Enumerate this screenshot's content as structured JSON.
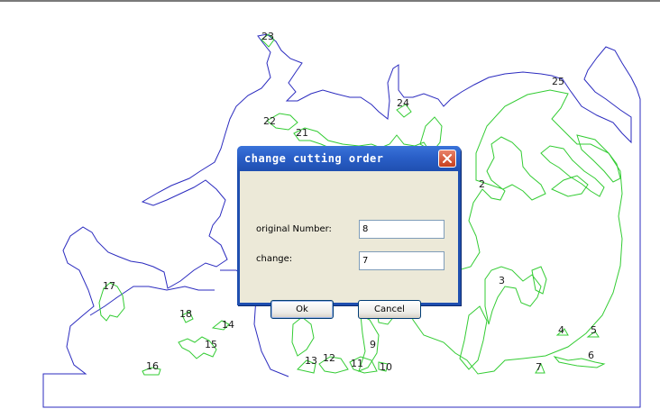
{
  "dialog": {
    "title": "change cutting order",
    "original_label": "original Number:",
    "original_value": "8",
    "change_label": "change:",
    "change_value": "7",
    "ok_label": "Ok",
    "cancel_label": "Cancel",
    "close_icon": "close-icon"
  },
  "drawing": {
    "outline_color": "#2b2bbf",
    "part_color": "#33cc33",
    "part_numbers": [
      "2",
      "3",
      "4",
      "5",
      "6",
      "7",
      "9",
      "10",
      "11",
      "12",
      "13",
      "14",
      "15",
      "16",
      "17",
      "18",
      "21",
      "22",
      "23",
      "24",
      "25"
    ]
  }
}
